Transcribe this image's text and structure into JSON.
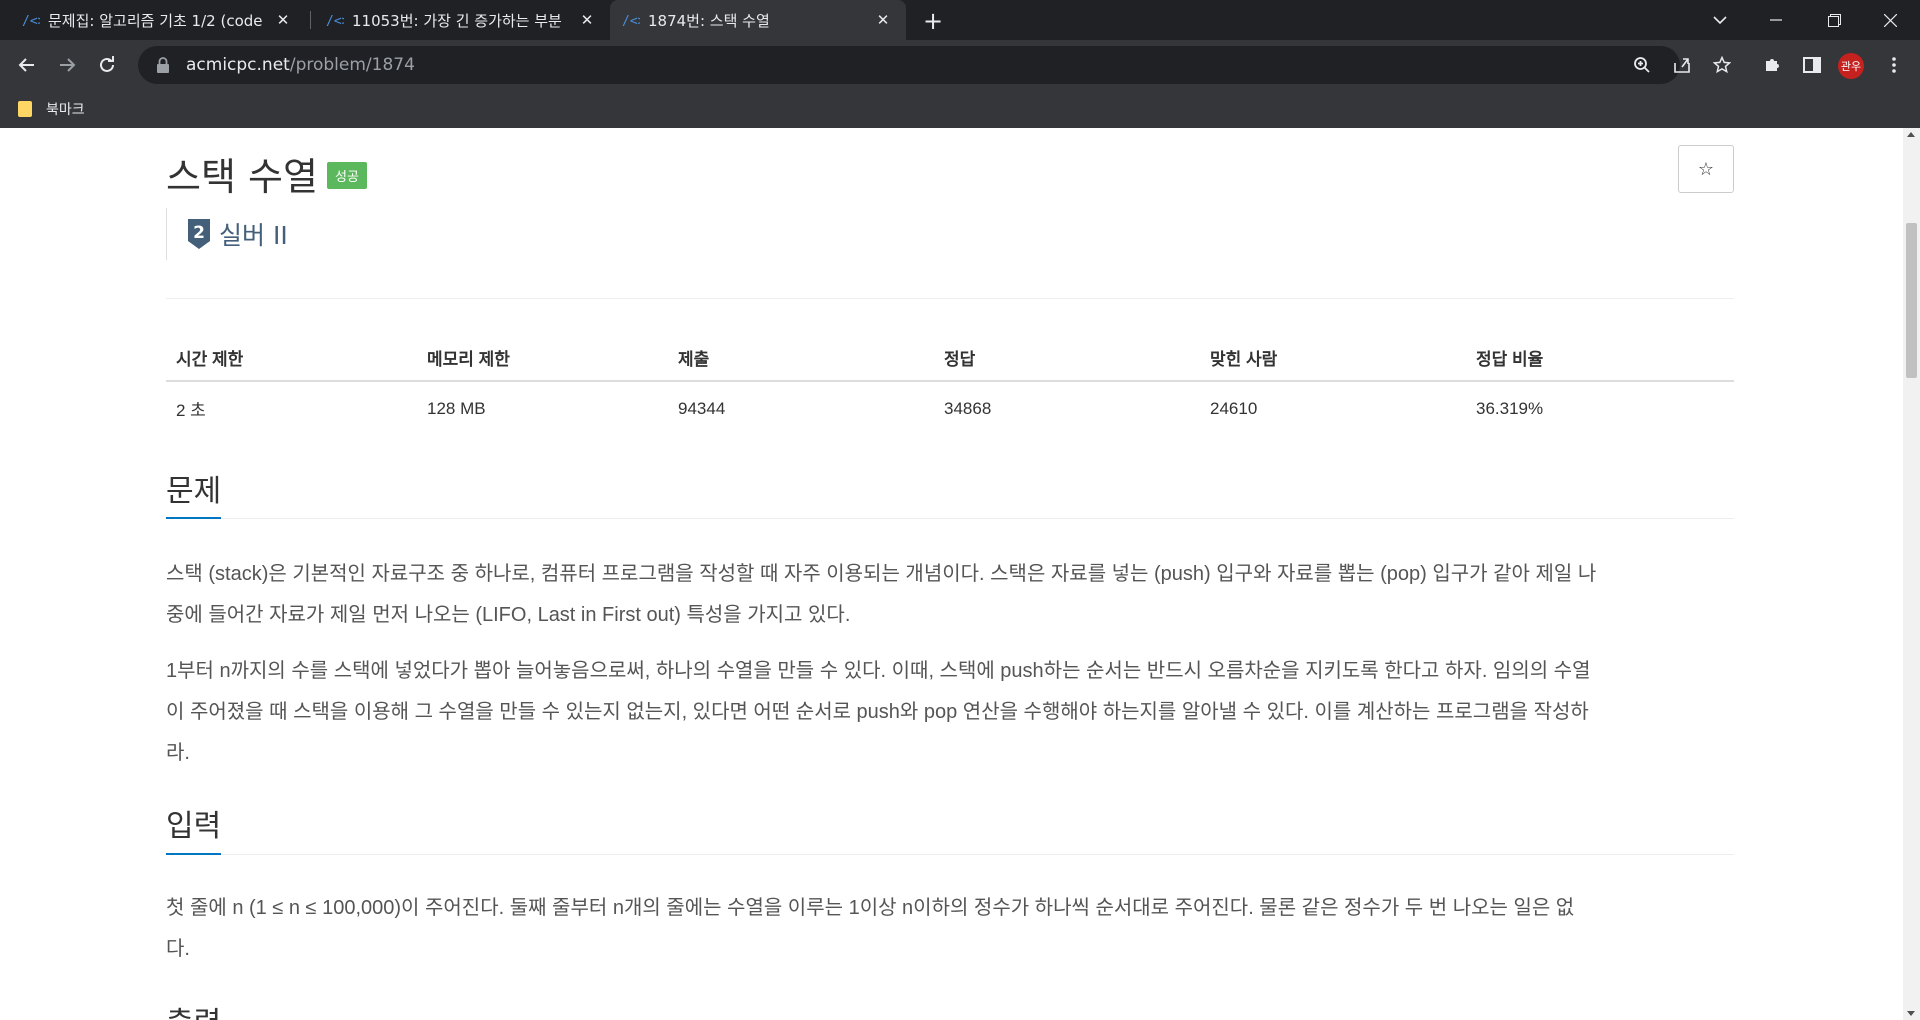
{
  "browser": {
    "tabs": [
      {
        "title": "문제집: 알고리즘 기초 1/2 (code",
        "active": false
      },
      {
        "title": "11053번: 가장 긴 증가하는 부분",
        "active": false
      },
      {
        "title": "1874번: 스택 수열",
        "active": true
      }
    ],
    "new_tab_label": "+",
    "url_host": "acmicpc.net",
    "url_path": "/problem/1874",
    "avatar_text": "관우",
    "bookmarks": [
      {
        "label": "북마크"
      }
    ]
  },
  "problem": {
    "title": "스택 수열",
    "status_badge": "성공",
    "star_label": "☆",
    "tier_number": "2",
    "tier_label": "실버 II",
    "info_headers": [
      "시간 제한",
      "메모리 제한",
      "제출",
      "정답",
      "맞힌 사람",
      "정답 비율"
    ],
    "info_values": [
      "2 초",
      "128 MB",
      "94344",
      "34868",
      "24610",
      "36.319%"
    ]
  },
  "sections": {
    "problem_heading": "문제",
    "problem_p1_line1": "스택 (stack)은 기본적인 자료구조 중 하나로, 컴퓨터 프로그램을 작성할 때 자주 이용되는 개념이다. 스택은 자료를 넣는 (push) 입구와 자료를 뽑는 (pop) 입구가 같아 제일 나",
    "problem_p1_line2": "중에 들어간 자료가 제일 먼저 나오는 (LIFO, Last in First out) 특성을 가지고 있다.",
    "problem_p2_line1": "1부터 n까지의 수를 스택에 넣었다가 뽑아 늘어놓음으로써, 하나의 수열을 만들 수 있다. 이때, 스택에 push하는 순서는 반드시 오름차순을 지키도록 한다고 하자. 임의의 수열",
    "problem_p2_line2": "이 주어졌을 때 스택을 이용해 그 수열을 만들 수 있는지 없는지, 있다면 어떤 순서로 push와 pop 연산을 수행해야 하는지를 알아낼 수 있다. 이를 계산하는 프로그램을 작성하",
    "problem_p2_line3": "라.",
    "input_heading": "입력",
    "input_line1": "첫 줄에 n (1 ≤ n ≤ 100,000)이 주어진다. 둘째 줄부터 n개의 줄에는 수열을 이루는 1이상 n이하의 정수가 하나씩 순서대로 주어진다. 물론 같은 정수가 두 번 나오는 일은 없",
    "input_line2": "다.",
    "output_heading": "출력"
  },
  "colors": {
    "chrome_dark": "#202124",
    "chrome_toolbar": "#35363a",
    "success_green": "#5cb85c",
    "section_accent": "#0076c0",
    "tier_color": "#435f7a"
  }
}
